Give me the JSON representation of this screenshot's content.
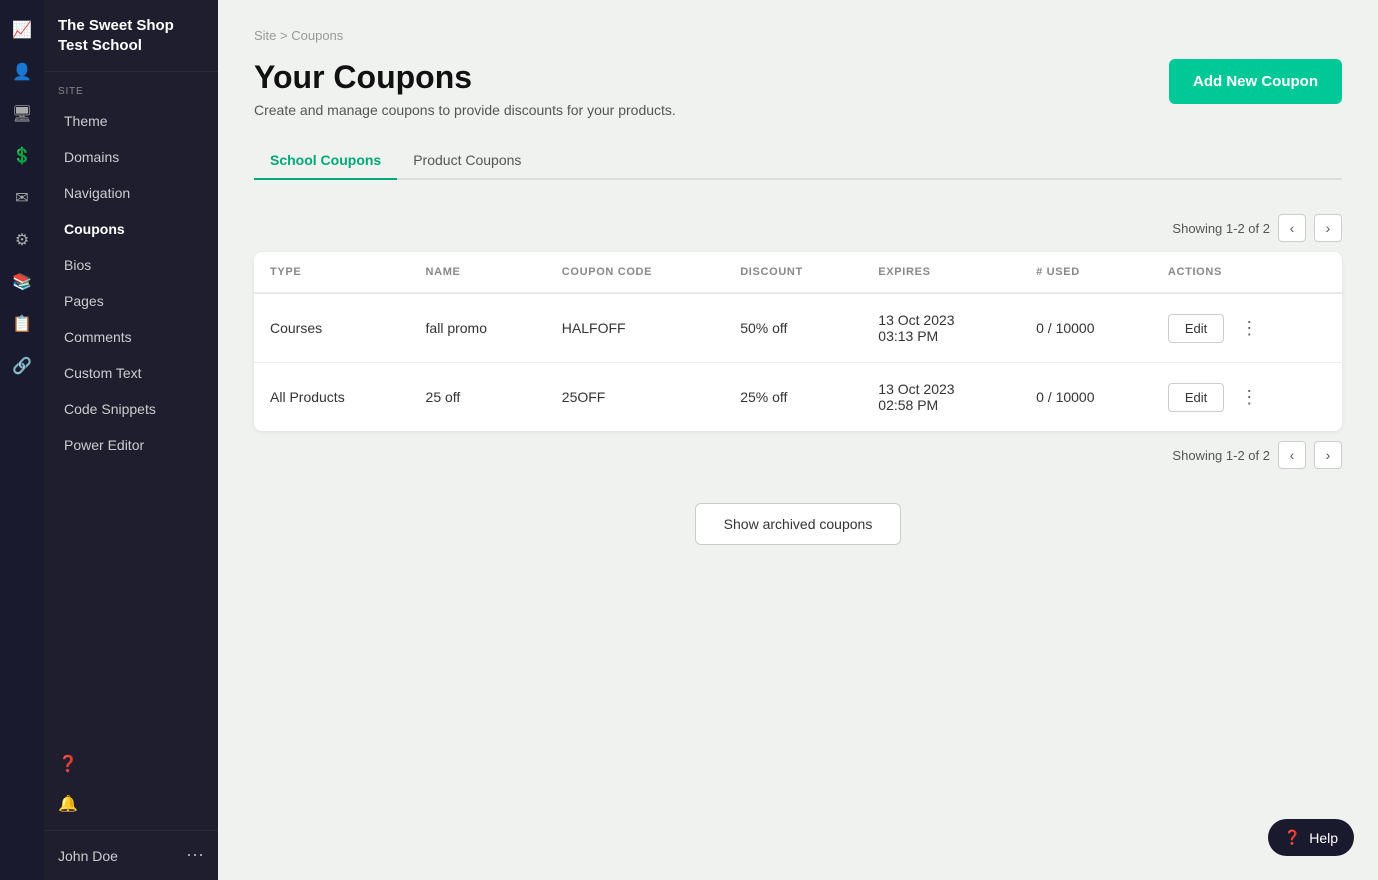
{
  "app": {
    "school_name": "The Sweet Shop Test School"
  },
  "sidebar": {
    "section_label": "SITE",
    "items": [
      {
        "id": "theme",
        "label": "Theme",
        "active": false
      },
      {
        "id": "domains",
        "label": "Domains",
        "active": false
      },
      {
        "id": "navigation",
        "label": "Navigation",
        "active": false
      },
      {
        "id": "coupons",
        "label": "Coupons",
        "active": true
      },
      {
        "id": "bios",
        "label": "Bios",
        "active": false
      },
      {
        "id": "pages",
        "label": "Pages",
        "active": false
      },
      {
        "id": "comments",
        "label": "Comments",
        "active": false
      },
      {
        "id": "custom-text",
        "label": "Custom Text",
        "active": false
      },
      {
        "id": "code-snippets",
        "label": "Code Snippets",
        "active": false
      },
      {
        "id": "power-editor",
        "label": "Power Editor",
        "active": false
      }
    ],
    "footer": {
      "user_name": "John Doe"
    }
  },
  "breadcrumb": {
    "site": "Site",
    "separator": ">",
    "current": "Coupons"
  },
  "page": {
    "title": "Your Coupons",
    "subtitle": "Create and manage coupons to provide discounts for your products.",
    "add_button_label": "Add New Coupon"
  },
  "tabs": [
    {
      "id": "school",
      "label": "School Coupons",
      "active": true
    },
    {
      "id": "product",
      "label": "Product Coupons",
      "active": false
    }
  ],
  "pagination": {
    "showing": "Showing 1-2 of 2"
  },
  "table": {
    "columns": [
      {
        "id": "type",
        "label": "TYPE"
      },
      {
        "id": "name",
        "label": "NAME"
      },
      {
        "id": "coupon_code",
        "label": "COUPON CODE"
      },
      {
        "id": "discount",
        "label": "DISCOUNT"
      },
      {
        "id": "expires",
        "label": "EXPIRES"
      },
      {
        "id": "used",
        "label": "# USED"
      },
      {
        "id": "actions",
        "label": "ACTIONS"
      }
    ],
    "rows": [
      {
        "type": "Courses",
        "name": "fall promo",
        "coupon_code": "HALFOFF",
        "discount": "50% off",
        "expires": "13 Oct 2023\n03:13 PM",
        "expires_line1": "13 Oct 2023",
        "expires_line2": "03:13 PM",
        "used": "0 / 10000"
      },
      {
        "type": "All Products",
        "name": "25 off",
        "coupon_code": "25OFF",
        "discount": "25% off",
        "expires": "13 Oct 2023\n02:58 PM",
        "expires_line1": "13 Oct 2023",
        "expires_line2": "02:58 PM",
        "used": "0 / 10000"
      }
    ]
  },
  "archive": {
    "button_label": "Show archived coupons"
  },
  "help": {
    "label": "Help"
  },
  "icons": {
    "analytics": "📈",
    "users": "👤",
    "monitor": "🖥",
    "dollar": "💲",
    "mail": "✉",
    "gear": "⚙",
    "pages": "📄",
    "list": "☰",
    "settings": "⚙"
  }
}
